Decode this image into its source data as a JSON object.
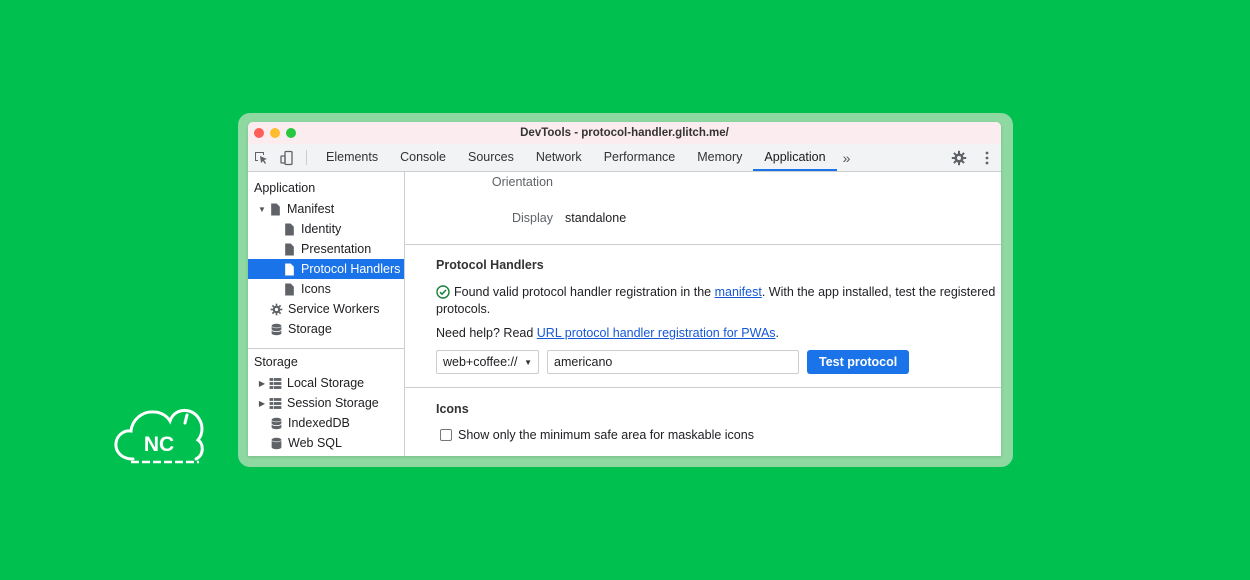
{
  "window": {
    "title": "DevTools - protocol-handler.glitch.me/"
  },
  "tabs": [
    {
      "label": "Elements"
    },
    {
      "label": "Console"
    },
    {
      "label": "Sources"
    },
    {
      "label": "Network"
    },
    {
      "label": "Performance"
    },
    {
      "label": "Memory"
    },
    {
      "label": "Application"
    }
  ],
  "tabs_more": "»",
  "sidebar": {
    "app_heading": "Application",
    "manifest": "Manifest",
    "identity": "Identity",
    "presentation": "Presentation",
    "protocol_handlers": "Protocol Handlers",
    "icons": "Icons",
    "service_workers": "Service Workers",
    "storage_item": "Storage",
    "storage_heading": "Storage",
    "local_storage": "Local Storage",
    "session_storage": "Session Storage",
    "indexeddb": "IndexedDB",
    "web_sql": "Web SQL"
  },
  "main": {
    "orientation_label": "Orientation",
    "display_label": "Display",
    "display_value": "standalone",
    "protocol": {
      "title": "Protocol Handlers",
      "found_text_1": "Found valid protocol handler registration in the ",
      "manifest_link": "manifest",
      "found_text_2": ". With the app installed, test the registered protocols.",
      "help_text": "Need help? Read ",
      "help_link": "URL protocol handler registration for PWAs",
      "help_end": ".",
      "select_value": "web+coffee://",
      "input_value": "americano",
      "test_button": "Test protocol"
    },
    "icons": {
      "title": "Icons",
      "checkbox_label": "Show only the minimum safe area for maskable icons"
    }
  },
  "logo": {
    "text": "NC"
  },
  "colors": {
    "background": "#00c050",
    "accent": "#1a73e8",
    "success": "#188038"
  }
}
